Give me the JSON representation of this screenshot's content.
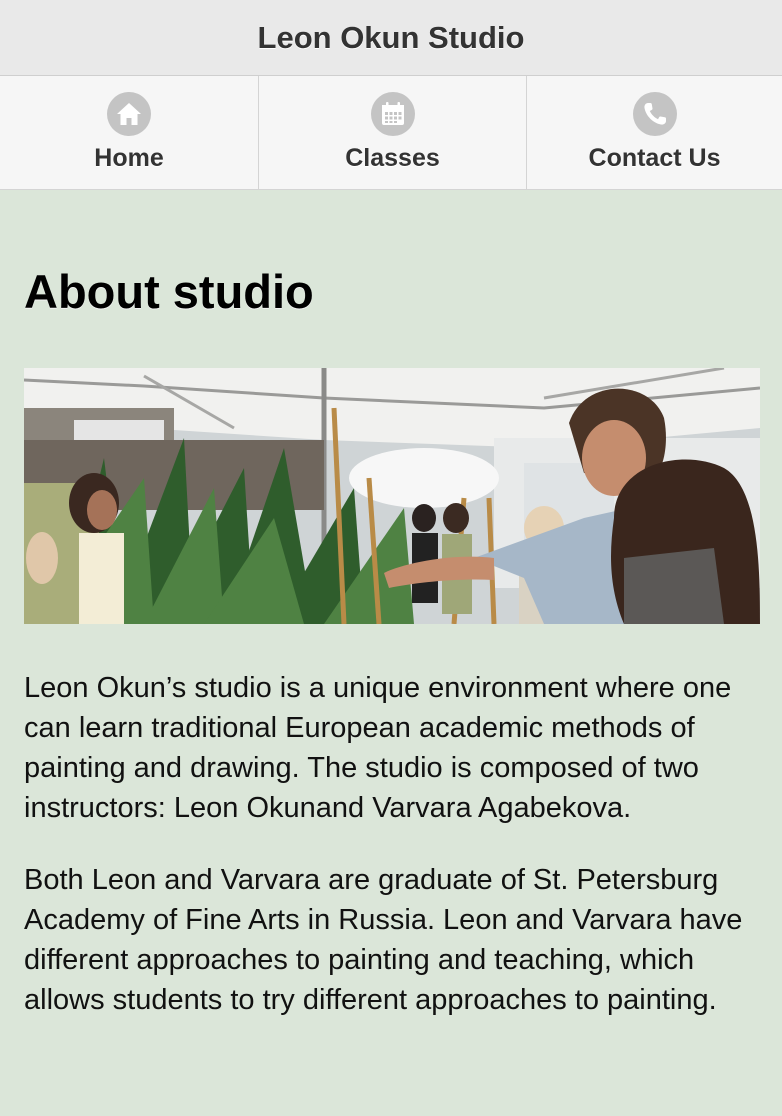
{
  "header": {
    "title": "Leon Okun Studio"
  },
  "nav": {
    "items": [
      {
        "label": "Home",
        "icon": "home-icon"
      },
      {
        "label": "Classes",
        "icon": "calendar-icon"
      },
      {
        "label": "Contact Us",
        "icon": "phone-icon"
      }
    ]
  },
  "main": {
    "heading": "About studio",
    "photo_alt": "Studio painting class outdoors",
    "paragraphs": [
      "Leon Okun’s studio is a unique environment where one can learn traditional European academic methods of painting and drawing. The studio is composed of two instructors: Leon Okunand Varvara Agabekova.",
      "Both Leon and Varvara are graduate of St. Petersburg Academy of Fine Arts in Russia. Leon and Varvara have different approaches to painting and teaching, which allows students to try different approaches to painting."
    ]
  },
  "colors": {
    "page_background": "#dbe6d9",
    "header_background": "#e9e9e9",
    "navbar_background": "#f6f6f6",
    "icon_background": "#c4c4c4"
  }
}
